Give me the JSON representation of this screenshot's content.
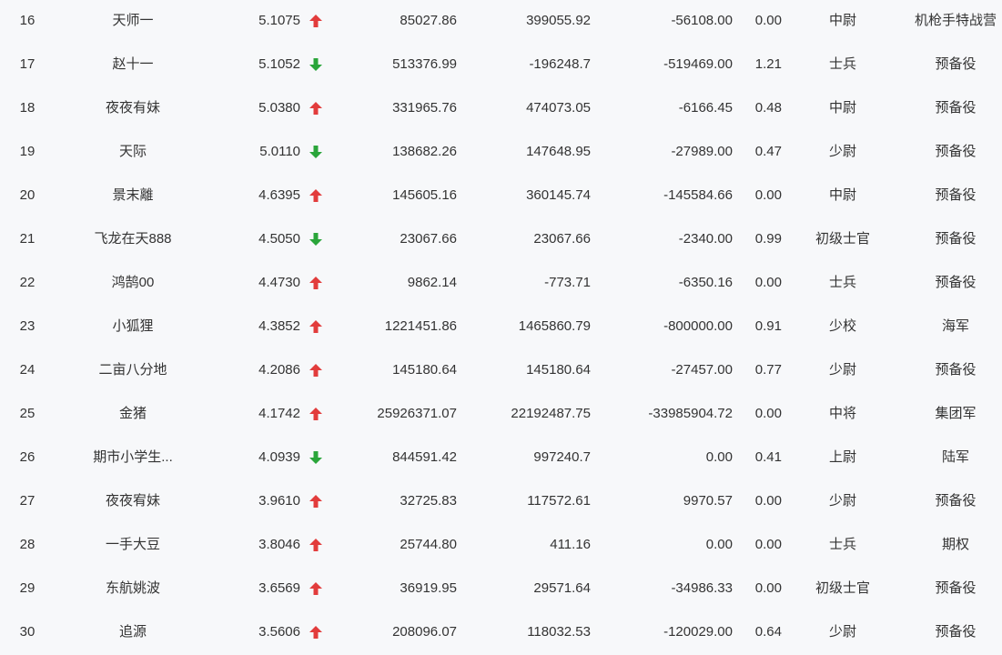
{
  "colors": {
    "up": "#e23c3c",
    "down": "#2aa53a",
    "text": "#333333",
    "background": "#f7f8fa"
  },
  "rows": [
    {
      "rank": "16",
      "name": "天师一",
      "score": "5.1075",
      "trend": "up",
      "v1": "85027.86",
      "v2": "399055.92",
      "v3": "-56108.00",
      "ratio": "0.00",
      "title": "中尉",
      "unit": "机枪手特战营"
    },
    {
      "rank": "17",
      "name": "赵十一",
      "score": "5.1052",
      "trend": "down",
      "v1": "513376.99",
      "v2": "-196248.7",
      "v3": "-519469.00",
      "ratio": "1.21",
      "title": "士兵",
      "unit": "预备役"
    },
    {
      "rank": "18",
      "name": "夜夜有妹",
      "score": "5.0380",
      "trend": "up",
      "v1": "331965.76",
      "v2": "474073.05",
      "v3": "-6166.45",
      "ratio": "0.48",
      "title": "中尉",
      "unit": "预备役"
    },
    {
      "rank": "19",
      "name": "天际",
      "score": "5.0110",
      "trend": "down",
      "v1": "138682.26",
      "v2": "147648.95",
      "v3": "-27989.00",
      "ratio": "0.47",
      "title": "少尉",
      "unit": "预备役"
    },
    {
      "rank": "20",
      "name": "景末離",
      "score": "4.6395",
      "trend": "up",
      "v1": "145605.16",
      "v2": "360145.74",
      "v3": "-145584.66",
      "ratio": "0.00",
      "title": "中尉",
      "unit": "预备役"
    },
    {
      "rank": "21",
      "name": "飞龙在天888",
      "score": "4.5050",
      "trend": "down",
      "v1": "23067.66",
      "v2": "23067.66",
      "v3": "-2340.00",
      "ratio": "0.99",
      "title": "初级士官",
      "unit": "预备役"
    },
    {
      "rank": "22",
      "name": "鸿鹄00",
      "score": "4.4730",
      "trend": "up",
      "v1": "9862.14",
      "v2": "-773.71",
      "v3": "-6350.16",
      "ratio": "0.00",
      "title": "士兵",
      "unit": "预备役"
    },
    {
      "rank": "23",
      "name": "小狐狸",
      "score": "4.3852",
      "trend": "up",
      "v1": "1221451.86",
      "v2": "1465860.79",
      "v3": "-800000.00",
      "ratio": "0.91",
      "title": "少校",
      "unit": "海军"
    },
    {
      "rank": "24",
      "name": "二亩八分地",
      "score": "4.2086",
      "trend": "up",
      "v1": "145180.64",
      "v2": "145180.64",
      "v3": "-27457.00",
      "ratio": "0.77",
      "title": "少尉",
      "unit": "预备役"
    },
    {
      "rank": "25",
      "name": "金猪",
      "score": "4.1742",
      "trend": "up",
      "v1": "25926371.07",
      "v2": "22192487.75",
      "v3": "-33985904.72",
      "ratio": "0.00",
      "title": "中将",
      "unit": "集团军"
    },
    {
      "rank": "26",
      "name": "期市小学生...",
      "score": "4.0939",
      "trend": "down",
      "v1": "844591.42",
      "v2": "997240.7",
      "v3": "0.00",
      "ratio": "0.41",
      "title": "上尉",
      "unit": "陆军"
    },
    {
      "rank": "27",
      "name": "夜夜宥妹",
      "score": "3.9610",
      "trend": "up",
      "v1": "32725.83",
      "v2": "117572.61",
      "v3": "9970.57",
      "ratio": "0.00",
      "title": "少尉",
      "unit": "预备役"
    },
    {
      "rank": "28",
      "name": "一手大豆",
      "score": "3.8046",
      "trend": "up",
      "v1": "25744.80",
      "v2": "411.16",
      "v3": "0.00",
      "ratio": "0.00",
      "title": "士兵",
      "unit": "期权"
    },
    {
      "rank": "29",
      "name": "东航姚波",
      "score": "3.6569",
      "trend": "up",
      "v1": "36919.95",
      "v2": "29571.64",
      "v3": "-34986.33",
      "ratio": "0.00",
      "title": "初级士官",
      "unit": "预备役"
    },
    {
      "rank": "30",
      "name": "追源",
      "score": "3.5606",
      "trend": "up",
      "v1": "208096.07",
      "v2": "118032.53",
      "v3": "-120029.00",
      "ratio": "0.64",
      "title": "少尉",
      "unit": "预备役"
    }
  ]
}
